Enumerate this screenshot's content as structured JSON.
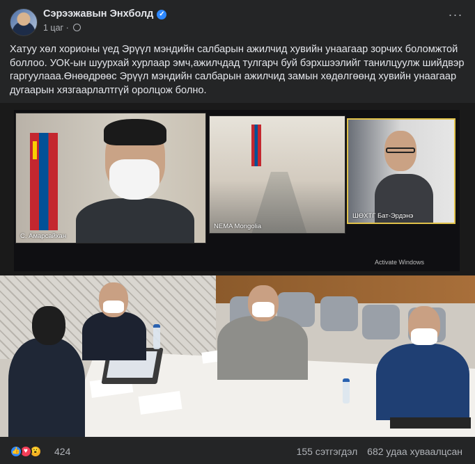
{
  "post": {
    "author": "Сэрээжавын Энхболд",
    "time": "1 цаг",
    "text": "Хатуу хөл хорионы үед Эрүүл мэндийн салбарын ажилчид хувийн унаагаар зорчих боломжтой боллоо. УОК-ын шуурхай хурлаар эмч,ажилчдад тулгарч буй бэрхшээлийг танилцуулж шийдвэр гаргуулааа.Өнөөдрөөс  Эрүүл мэндийн салбарын ажилчид замын хөдөлгөөнд хувийн унаагаар  дугаарын хязгаарлалтгүй оролцож болно."
  },
  "photo": {
    "video_labels": {
      "left": "С. Амарсайхан",
      "middle": "NEMA Mongolia",
      "right": "ШӨХТГ Бат-Эрдэнэ"
    },
    "watermark": "Activate Windows"
  },
  "footer": {
    "reaction_count": "424",
    "comments": "155 сэтгэгдэл",
    "shares": "682 удаа хуваалцсан"
  },
  "icons": [
    "more-icon",
    "globe-icon",
    "verified-icon",
    "like-icon",
    "love-icon",
    "wow-icon"
  ],
  "colors": {
    "background": "#242526",
    "text": "#e4e6eb",
    "secondary": "#b0b3b8",
    "accent": "#2d88ff"
  }
}
